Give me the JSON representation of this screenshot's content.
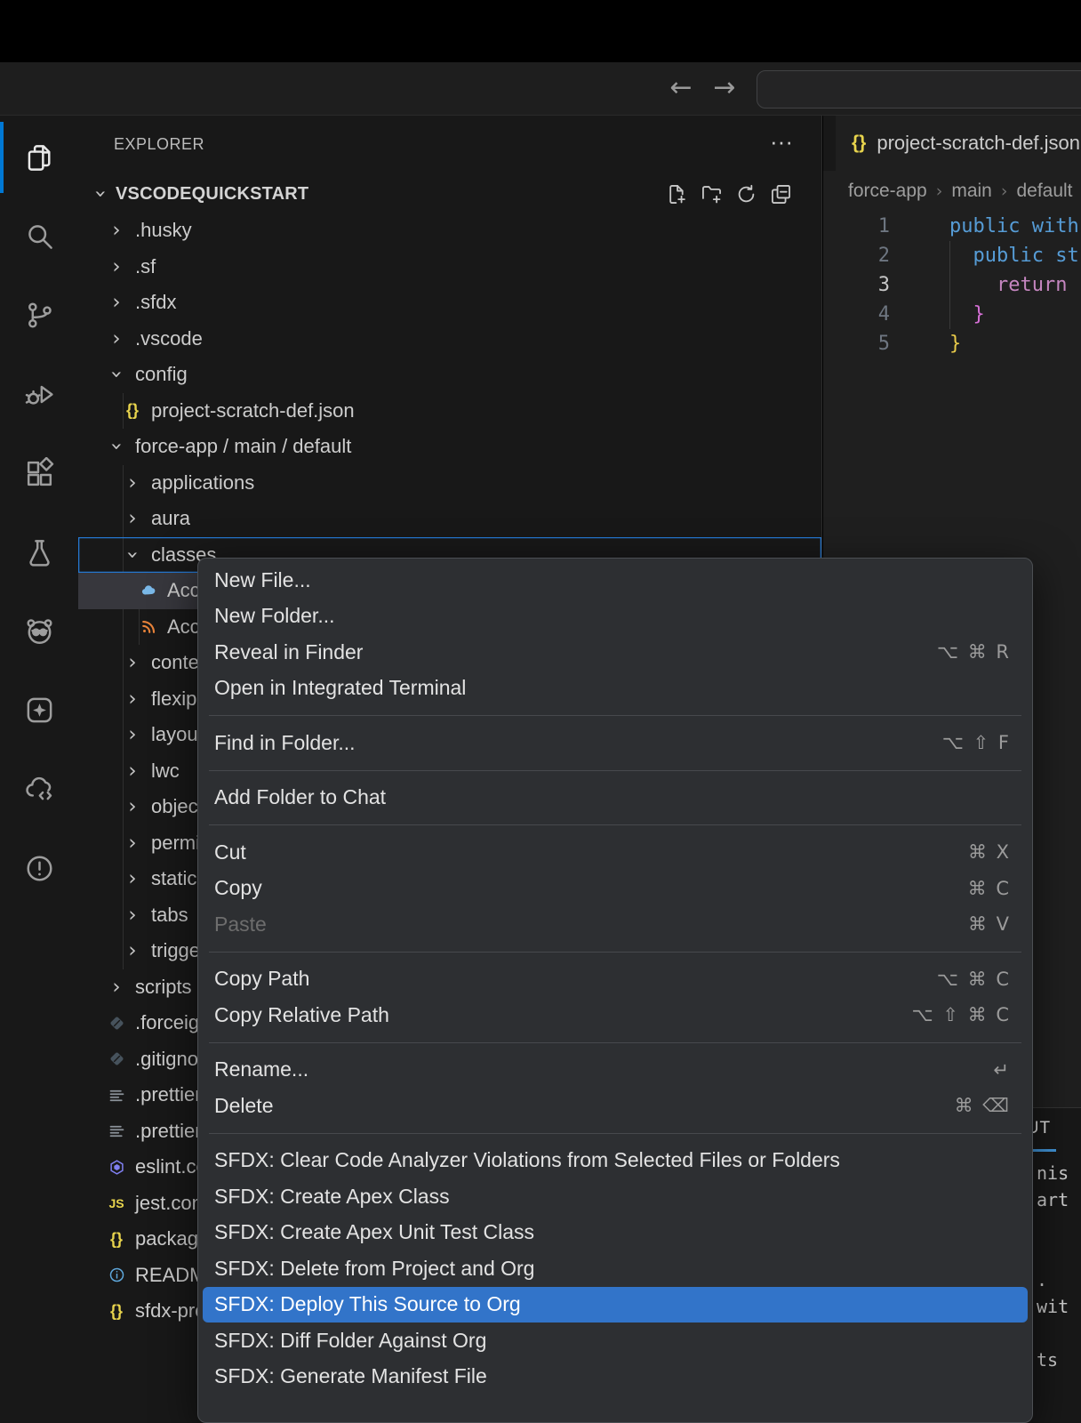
{
  "titlebar": {
    "back_arrow": "←",
    "forward_arrow": "→",
    "search_value": ""
  },
  "activity_bar": {
    "items": [
      {
        "name": "explorer",
        "active": true
      },
      {
        "name": "search",
        "active": false
      },
      {
        "name": "source-control",
        "active": false
      },
      {
        "name": "run-and-debug",
        "active": false
      },
      {
        "name": "extensions",
        "active": false
      },
      {
        "name": "testing",
        "active": false
      },
      {
        "name": "code-analyzer",
        "active": false
      },
      {
        "name": "agentforce",
        "active": false
      },
      {
        "name": "cloud-code",
        "active": false
      },
      {
        "name": "problems",
        "active": false
      }
    ]
  },
  "explorer": {
    "header": "EXPLORER",
    "overflow": "···",
    "section": "VSCODEQUICKSTART",
    "actions": [
      "new-file",
      "new-folder",
      "refresh",
      "collapse-all"
    ],
    "tree": [
      {
        "label": ".husky",
        "level": 0,
        "kind": "folder",
        "expanded": false
      },
      {
        "label": ".sf",
        "level": 0,
        "kind": "folder",
        "expanded": false
      },
      {
        "label": ".sfdx",
        "level": 0,
        "kind": "folder",
        "expanded": false
      },
      {
        "label": ".vscode",
        "level": 0,
        "kind": "folder",
        "expanded": false
      },
      {
        "label": "config",
        "level": 0,
        "kind": "folder",
        "expanded": true
      },
      {
        "label": "project-scratch-def.json",
        "level": 1,
        "kind": "file",
        "icon": "braces-icon"
      },
      {
        "label": "force-app / main / default",
        "level": 0,
        "kind": "folder",
        "expanded": true
      },
      {
        "label": "applications",
        "level": 1,
        "kind": "folder",
        "expanded": false
      },
      {
        "label": "aura",
        "level": 1,
        "kind": "folder",
        "expanded": false
      },
      {
        "label": "classes",
        "level": 1,
        "kind": "folder",
        "expanded": true,
        "focused": true
      },
      {
        "label": "AccountController.cls",
        "level": 2,
        "kind": "file",
        "icon": "apex-cloud-icon",
        "selected": true
      },
      {
        "label": "AccountController.cls-meta.xml",
        "level": 2,
        "kind": "file",
        "icon": "xml-feed-icon"
      },
      {
        "label": "contentassets",
        "level": 1,
        "kind": "folder",
        "expanded": false
      },
      {
        "label": "flexipages",
        "level": 1,
        "kind": "folder",
        "expanded": false
      },
      {
        "label": "layouts",
        "level": 1,
        "kind": "folder",
        "expanded": false
      },
      {
        "label": "lwc",
        "level": 1,
        "kind": "folder",
        "expanded": false
      },
      {
        "label": "objects",
        "level": 1,
        "kind": "folder",
        "expanded": false
      },
      {
        "label": "permissionsets",
        "level": 1,
        "kind": "folder",
        "expanded": false
      },
      {
        "label": "staticresources",
        "level": 1,
        "kind": "folder",
        "expanded": false
      },
      {
        "label": "tabs",
        "level": 1,
        "kind": "folder",
        "expanded": false
      },
      {
        "label": "triggers",
        "level": 1,
        "kind": "folder",
        "expanded": false
      },
      {
        "label": "scripts",
        "level": 0,
        "kind": "folder",
        "expanded": false
      },
      {
        "label": ".forceignore",
        "level": 0,
        "kind": "file",
        "icon": "ignore-icon"
      },
      {
        "label": ".gitignore",
        "level": 0,
        "kind": "file",
        "icon": "ignore-icon"
      },
      {
        "label": ".prettierignore",
        "level": 0,
        "kind": "file",
        "icon": "prettier-icon"
      },
      {
        "label": ".prettierrc",
        "level": 0,
        "kind": "file",
        "icon": "prettier-icon"
      },
      {
        "label": "eslint.config.mjs",
        "level": 0,
        "kind": "file",
        "icon": "eslint-icon"
      },
      {
        "label": "jest.config.js",
        "level": 0,
        "kind": "file",
        "icon": "js-icon"
      },
      {
        "label": "package.json",
        "level": 0,
        "kind": "file",
        "icon": "braces-icon"
      },
      {
        "label": "README.md",
        "level": 0,
        "kind": "file",
        "icon": "info-icon"
      },
      {
        "label": "sfdx-project.json",
        "level": 0,
        "kind": "file",
        "icon": "braces-icon"
      }
    ]
  },
  "editor": {
    "tab": {
      "icon": "{}",
      "label": "project-scratch-def.json"
    },
    "breadcrumbs": [
      "force-app",
      "main",
      "default"
    ],
    "lines": [
      {
        "num": "1",
        "text": "public with",
        "color": "keyword",
        "active": false
      },
      {
        "num": "2",
        "text": "  public st",
        "color": "keyword",
        "active": false
      },
      {
        "num": "3",
        "text": "    return",
        "color": "control",
        "active": true
      },
      {
        "num": "4",
        "text": "  }",
        "color": "bracket2",
        "active": false
      },
      {
        "num": "5",
        "text": "}",
        "color": "bracket1",
        "active": false
      }
    ]
  },
  "output_panel": {
    "tab": "OUTPUT",
    "lines": [
      "nis",
      "art",
      "",
      "",
      ".",
      "wit",
      "",
      "ts"
    ]
  },
  "context_menu": {
    "items": [
      {
        "label": "New File..."
      },
      {
        "label": "New Folder..."
      },
      {
        "label": "Reveal in Finder",
        "shortcut": "⌥ ⌘ R"
      },
      {
        "label": "Open in Integrated Terminal"
      },
      {
        "separator": true
      },
      {
        "label": "Find in Folder...",
        "shortcut": "⌥ ⇧ F"
      },
      {
        "separator": true
      },
      {
        "label": "Add Folder to Chat"
      },
      {
        "separator": true
      },
      {
        "label": "Cut",
        "shortcut": "⌘ X"
      },
      {
        "label": "Copy",
        "shortcut": "⌘ C"
      },
      {
        "label": "Paste",
        "shortcut": "⌘ V",
        "disabled": true
      },
      {
        "separator": true
      },
      {
        "label": "Copy Path",
        "shortcut": "⌥ ⌘ C"
      },
      {
        "label": "Copy Relative Path",
        "shortcut": "⌥ ⇧ ⌘ C"
      },
      {
        "separator": true
      },
      {
        "label": "Rename...",
        "shortcut": "↵"
      },
      {
        "label": "Delete",
        "shortcut": "⌘ ⌫"
      },
      {
        "separator": true
      },
      {
        "label": "SFDX: Clear Code Analyzer Violations from Selected Files or Folders"
      },
      {
        "label": "SFDX: Create Apex Class"
      },
      {
        "label": "SFDX: Create Apex Unit Test Class"
      },
      {
        "label": "SFDX: Delete from Project and Org"
      },
      {
        "label": "SFDX: Deploy This Source to Org",
        "selected": true
      },
      {
        "label": "SFDX: Diff Folder Against Org"
      },
      {
        "label": "SFDX: Generate Manifest File"
      }
    ]
  },
  "colors": {
    "selection_blue": "#3274c9",
    "focus_border": "#2577d0",
    "activity_indicator": "#0078d4",
    "json_yellow": "#e8d44d",
    "keyword_blue": "#569cd6",
    "control_pink": "#c586c0",
    "bracket_yellow": "#e9cb4a",
    "bracket_magenta": "#d670d6"
  }
}
